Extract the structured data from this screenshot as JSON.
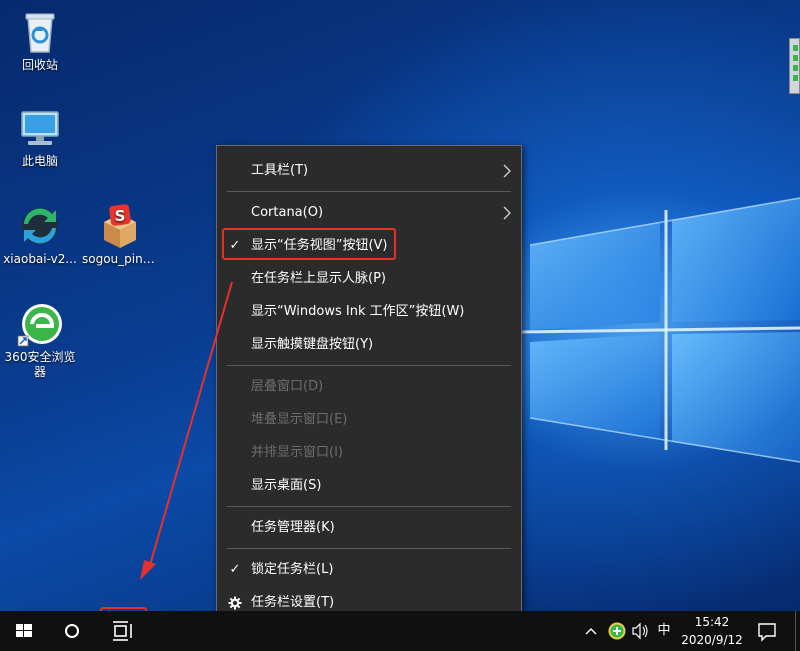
{
  "desktop": {
    "icons": [
      {
        "label": "回收站",
        "icon": "recycle-bin-icon"
      },
      {
        "label": "此电脑",
        "icon": "this-pc-icon"
      },
      {
        "label": "xiaobai-v2...",
        "icon": "xiaobai-icon"
      },
      {
        "label": "sogou_piny...",
        "icon": "sogou-icon"
      },
      {
        "label": "360安全浏览器",
        "icon": "browser-360-icon"
      }
    ]
  },
  "context_menu": {
    "items": [
      {
        "label": "工具栏(T)",
        "submenu": true
      },
      {
        "label": "Cortana(O)",
        "submenu": true
      },
      {
        "label": "显示“任务视图”按钮(V)",
        "checked": true
      },
      {
        "label": "在任务栏上显示人脉(P)"
      },
      {
        "label": "显示“Windows Ink 工作区”按钮(W)"
      },
      {
        "label": "显示触摸键盘按钮(Y)"
      },
      {
        "label": "层叠窗口(D)",
        "disabled": true
      },
      {
        "label": "堆叠显示窗口(E)",
        "disabled": true
      },
      {
        "label": "并排显示窗口(I)",
        "disabled": true
      },
      {
        "label": "显示桌面(S)"
      },
      {
        "label": "任务管理器(K)"
      },
      {
        "label": "锁定任务栏(L)",
        "checked": true
      },
      {
        "label": "任务栏设置(T)",
        "icon": "gear-icon"
      }
    ],
    "check_glyph": "✓"
  },
  "taskbar": {
    "ime": "中",
    "clock": {
      "time": "15:42",
      "date": "2020/9/12"
    }
  },
  "colors": {
    "menu_bg": "#2b2b2b",
    "annotation_red": "#e8302a",
    "taskbar_bg": "#101010"
  }
}
